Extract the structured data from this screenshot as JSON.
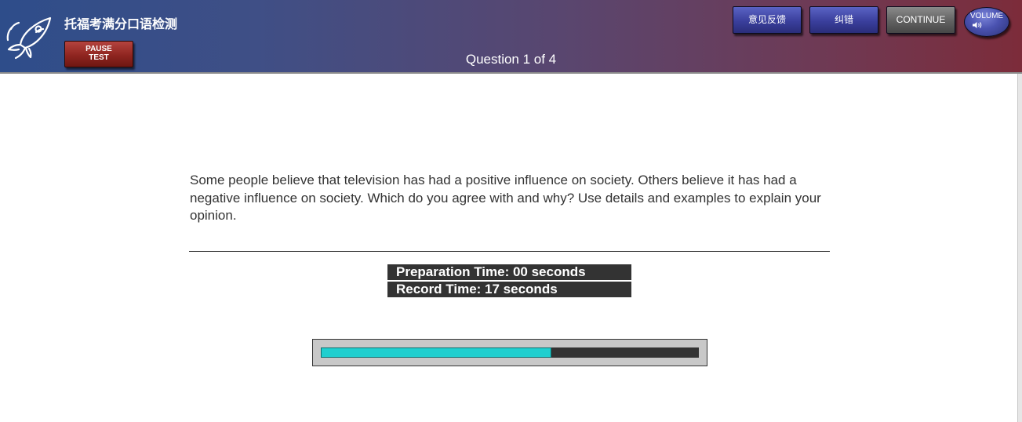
{
  "header": {
    "app_title": "托福考满分口语检测",
    "pause_button": {
      "line1": "PAUSE",
      "line2": "TEST"
    },
    "question_count": "Question 1 of 4",
    "buttons": {
      "feedback": "意见反馈",
      "correction": "纠错",
      "continue": "CONTINUE",
      "volume": "VOLUME"
    },
    "icons": {
      "logo": "rocket-logo-icon",
      "volume": "speaker-icon"
    },
    "colors": {
      "gradient_left": "#2e4d8a",
      "gradient_right": "#7c2c3a",
      "blue_button": "#3a3f9c",
      "pause_button": "#8f2520",
      "continue_button": "#616161"
    }
  },
  "main": {
    "prompt": "Some people believe that television has had a positive influence on society. Others believe it has had a negative influence on society. Which do you agree with and why? Use details and examples to explain your opinion.",
    "preparation_time": "Preparation Time: 00 seconds",
    "record_time": "Record Time: 17 seconds",
    "record_progress_fraction": 0.61,
    "colors": {
      "timer_background": "#333333",
      "progress_fill": "#1fcfcf",
      "progress_track": "#333333",
      "progress_frame": "#c8c8c8"
    }
  }
}
